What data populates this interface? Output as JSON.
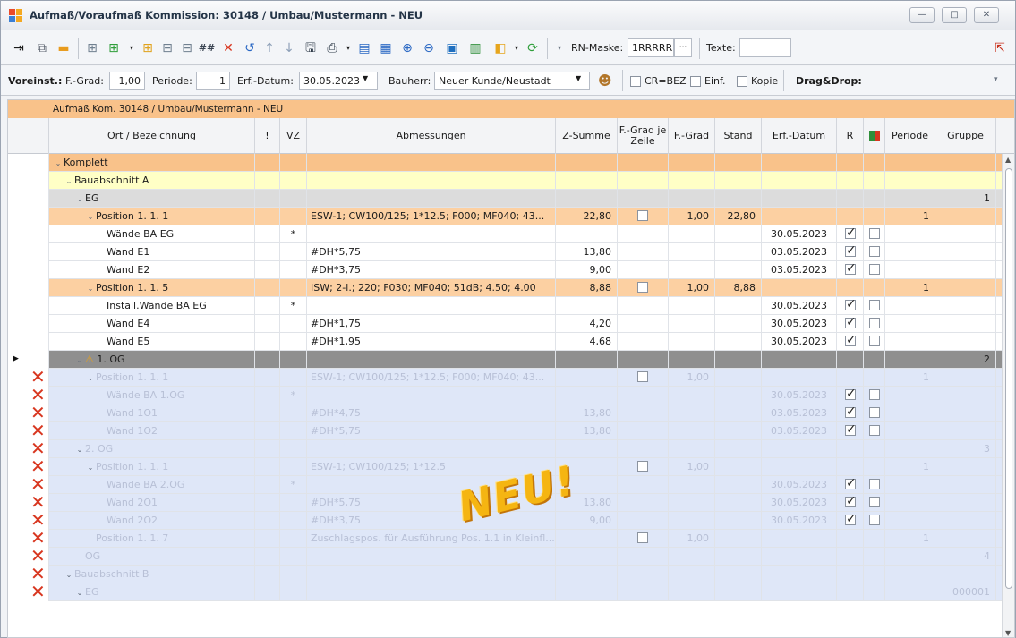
{
  "window": {
    "title": "Aufmaß/Voraufmaß Kommission: 30148 / Umbau/Mustermann - NEU",
    "buttons": {
      "minimize": "—",
      "maximize": "□",
      "close": "✕"
    }
  },
  "toolbar": {
    "rn_mask_label": "RN-Maske:",
    "rn_mask_value": "1RRRRRR",
    "texte_label": "Texte:",
    "texte_value": ""
  },
  "settings": {
    "voreinst_label": "Voreinst.:",
    "fgrad_label": "F.-Grad:",
    "fgrad_value": "1,00",
    "periode_label": "Periode:",
    "periode_value": "1",
    "erfdatum_label": "Erf.-Datum:",
    "erfdatum_value": "30.05.2023",
    "bauherr_label": "Bauherr:",
    "bauherr_value": "Neuer Kunde/Neustadt",
    "cr_label": "CR=BEZ",
    "einf_label": "Einf.",
    "kopie_label": "Kopie",
    "dragdrop_label": "Drag&Drop:"
  },
  "grid": {
    "group_label": "Aufmaß Kom. 30148 / Umbau/Mustermann - NEU",
    "columns": [
      "Ort / Bezeichnung",
      "!",
      "VZ",
      "Abmessungen",
      "Z-Summe",
      "F.-Grad je Zeile",
      "F.-Grad",
      "Stand",
      "Erf.-Datum",
      "R",
      "",
      "Periode",
      "Gruppe"
    ],
    "rows": [
      {
        "depth": 0,
        "exp": "⌄",
        "name": "Komplett",
        "type": "top",
        "excl": "",
        "vz": "",
        "abm": "",
        "zsum": "",
        "fgz": false,
        "fgrad": "",
        "stand": "",
        "erf": "",
        "r": false,
        "x": false,
        "periode": "",
        "gruppe": ""
      },
      {
        "depth": 1,
        "exp": "⌄",
        "name": "Bauabschnitt A",
        "type": "ba",
        "excl": "",
        "vz": "",
        "abm": "",
        "zsum": "",
        "fgz": false,
        "fgrad": "",
        "stand": "",
        "erf": "",
        "r": false,
        "x": false,
        "periode": "",
        "gruppe": ""
      },
      {
        "depth": 2,
        "exp": "⌄",
        "name": "EG",
        "type": "floor",
        "excl": "",
        "vz": "",
        "abm": "",
        "zsum": "",
        "fgz": false,
        "fgrad": "",
        "stand": "",
        "erf": "",
        "r": false,
        "x": false,
        "periode": "",
        "gruppe": "1"
      },
      {
        "depth": 3,
        "exp": "⌄",
        "name": "Position  1.  1.  1",
        "type": "pos",
        "excl": "",
        "vz": "",
        "abm": "ESW-1; CW100/125; 1*12.5; F000; MF040; 43...",
        "zsum": "22,80",
        "fgz": true,
        "fgrad": "1,00",
        "stand": "22,80",
        "erf": "",
        "r": false,
        "x": false,
        "periode": "1",
        "gruppe": ""
      },
      {
        "depth": 4,
        "exp": "",
        "name": "Wände BA EG",
        "type": "line",
        "excl": "",
        "vz": "*",
        "abm": "",
        "zsum": "",
        "fgz": false,
        "fgrad": "",
        "stand": "",
        "erf": "30.05.2023",
        "r": true,
        "x": true,
        "periode": "",
        "gruppe": ""
      },
      {
        "depth": 4,
        "exp": "",
        "name": "Wand E1",
        "type": "line",
        "excl": "",
        "vz": "",
        "abm": "#DH*5,75",
        "zsum": "13,80",
        "fgz": false,
        "fgrad": "",
        "stand": "",
        "erf": "03.05.2023",
        "r": true,
        "x": true,
        "periode": "",
        "gruppe": ""
      },
      {
        "depth": 4,
        "exp": "",
        "name": "Wand E2",
        "type": "line",
        "excl": "",
        "vz": "",
        "abm": "#DH*3,75",
        "zsum": "9,00",
        "fgz": false,
        "fgrad": "",
        "stand": "",
        "erf": "03.05.2023",
        "r": true,
        "x": true,
        "periode": "",
        "gruppe": ""
      },
      {
        "depth": 3,
        "exp": "⌄",
        "name": "Position  1.  1.  5",
        "type": "pos",
        "excl": "",
        "vz": "",
        "abm": "ISW; 2-l.; 220; F030; MF040; 51dB; 4.50; 4.00",
        "zsum": "8,88",
        "fgz": true,
        "fgrad": "1,00",
        "stand": "8,88",
        "erf": "",
        "r": false,
        "x": false,
        "periode": "1",
        "gruppe": ""
      },
      {
        "depth": 4,
        "exp": "",
        "name": "Install.Wände BA EG",
        "type": "line",
        "excl": "",
        "vz": "*",
        "abm": "",
        "zsum": "",
        "fgz": false,
        "fgrad": "",
        "stand": "",
        "erf": "30.05.2023",
        "r": true,
        "x": true,
        "periode": "",
        "gruppe": ""
      },
      {
        "depth": 4,
        "exp": "",
        "name": "Wand E4",
        "type": "line",
        "excl": "",
        "vz": "",
        "abm": "#DH*1,75",
        "zsum": "4,20",
        "fgz": false,
        "fgrad": "",
        "stand": "",
        "erf": "30.05.2023",
        "r": true,
        "x": true,
        "periode": "",
        "gruppe": ""
      },
      {
        "depth": 4,
        "exp": "",
        "name": "Wand E5",
        "type": "line",
        "excl": "",
        "vz": "",
        "abm": "#DH*1,95",
        "zsum": "4,68",
        "fgz": false,
        "fgrad": "",
        "stand": "",
        "erf": "30.05.2023",
        "r": true,
        "x": true,
        "periode": "",
        "gruppe": ""
      },
      {
        "depth": 2,
        "exp": "⌄",
        "name": "1. OG",
        "type": "selected",
        "warn": true,
        "excl": "",
        "vz": "",
        "abm": "",
        "zsum": "",
        "fgz": false,
        "fgrad": "",
        "stand": "",
        "erf": "",
        "r": false,
        "x": false,
        "periode": "",
        "gruppe": "2"
      },
      {
        "depth": 3,
        "exp": "⌄",
        "name": "Position  1.  1.  1",
        "type": "del",
        "excl": "",
        "vz": "",
        "abm": "ESW-1; CW100/125; 1*12.5; F000; MF040; 43...",
        "zsum": "",
        "fgz": true,
        "fgrad": "1,00",
        "stand": "",
        "erf": "",
        "r": false,
        "x": false,
        "periode": "1",
        "gruppe": ""
      },
      {
        "depth": 4,
        "exp": "",
        "name": "Wände BA 1.OG",
        "type": "del",
        "excl": "",
        "vz": "*",
        "abm": "",
        "zsum": "",
        "fgz": false,
        "fgrad": "",
        "stand": "",
        "erf": "30.05.2023",
        "r": true,
        "x": true,
        "periode": "",
        "gruppe": ""
      },
      {
        "depth": 4,
        "exp": "",
        "name": "Wand 1O1",
        "type": "del",
        "excl": "",
        "vz": "",
        "abm": "#DH*4,75",
        "zsum": "13,80",
        "fgz": false,
        "fgrad": "",
        "stand": "",
        "erf": "03.05.2023",
        "r": true,
        "x": true,
        "periode": "",
        "gruppe": ""
      },
      {
        "depth": 4,
        "exp": "",
        "name": "Wand 1O2",
        "type": "del",
        "excl": "",
        "vz": "",
        "abm": "#DH*5,75",
        "zsum": "13,80",
        "fgz": false,
        "fgrad": "",
        "stand": "",
        "erf": "03.05.2023",
        "r": true,
        "x": true,
        "periode": "",
        "gruppe": ""
      },
      {
        "depth": 2,
        "exp": "⌄",
        "name": "2. OG",
        "type": "del",
        "excl": "",
        "vz": "",
        "abm": "",
        "zsum": "",
        "fgz": false,
        "fgrad": "",
        "stand": "",
        "erf": "",
        "r": false,
        "x": false,
        "periode": "",
        "gruppe": "3"
      },
      {
        "depth": 3,
        "exp": "⌄",
        "name": "Position  1.  1.  1",
        "type": "del",
        "excl": "",
        "vz": "",
        "abm": "ESW-1; CW100/125; 1*12.5",
        "zsum": "",
        "fgz": true,
        "fgrad": "1,00",
        "stand": "",
        "erf": "",
        "r": false,
        "x": false,
        "periode": "1",
        "gruppe": ""
      },
      {
        "depth": 4,
        "exp": "",
        "name": "Wände BA 2.OG",
        "type": "del",
        "excl": "",
        "vz": "*",
        "abm": "",
        "zsum": "",
        "fgz": false,
        "fgrad": "",
        "stand": "",
        "erf": "30.05.2023",
        "r": true,
        "x": true,
        "periode": "",
        "gruppe": ""
      },
      {
        "depth": 4,
        "exp": "",
        "name": "Wand 2O1",
        "type": "del",
        "excl": "",
        "vz": "",
        "abm": "#DH*5,75",
        "zsum": "13,80",
        "fgz": false,
        "fgrad": "",
        "stand": "",
        "erf": "30.05.2023",
        "r": true,
        "x": true,
        "periode": "",
        "gruppe": ""
      },
      {
        "depth": 4,
        "exp": "",
        "name": "Wand 2O2",
        "type": "del",
        "excl": "",
        "vz": "",
        "abm": "#DH*3,75",
        "zsum": "9,00",
        "fgz": false,
        "fgrad": "",
        "stand": "",
        "erf": "30.05.2023",
        "r": true,
        "x": true,
        "periode": "",
        "gruppe": ""
      },
      {
        "depth": 3,
        "exp": "",
        "name": "Position  1.  1.  7",
        "type": "del",
        "excl": "",
        "vz": "",
        "abm": "Zuschlagspos. für Ausführung Pos. 1.1 in Kleinfl...",
        "zsum": "",
        "fgz": true,
        "fgrad": "1,00",
        "stand": "",
        "erf": "",
        "r": false,
        "x": false,
        "periode": "1",
        "gruppe": ""
      },
      {
        "depth": 2,
        "exp": "",
        "name": "OG",
        "type": "del",
        "excl": "",
        "vz": "",
        "abm": "",
        "zsum": "",
        "fgz": false,
        "fgrad": "",
        "stand": "",
        "erf": "",
        "r": false,
        "x": false,
        "periode": "",
        "gruppe": "4"
      },
      {
        "depth": 1,
        "exp": "⌄",
        "name": "Bauabschnitt B",
        "type": "del",
        "excl": "",
        "vz": "",
        "abm": "",
        "zsum": "",
        "fgz": false,
        "fgrad": "",
        "stand": "",
        "erf": "",
        "r": false,
        "x": false,
        "periode": "",
        "gruppe": ""
      },
      {
        "depth": 2,
        "exp": "⌄",
        "name": "EG",
        "type": "del",
        "excl": "",
        "vz": "",
        "abm": "",
        "zsum": "",
        "fgz": false,
        "fgrad": "",
        "stand": "",
        "erf": "",
        "r": false,
        "x": false,
        "periode": "",
        "gruppe": "000001"
      }
    ]
  },
  "stamp_text": "NEU!",
  "colors": {
    "top": "#f9c28a",
    "ba": "#ffffc6",
    "floor": "#dcdcdc",
    "pos": "#fcd0a2",
    "selected": "#8f8f8f",
    "del": "#dfe7f8",
    "line": "#ffffff"
  }
}
